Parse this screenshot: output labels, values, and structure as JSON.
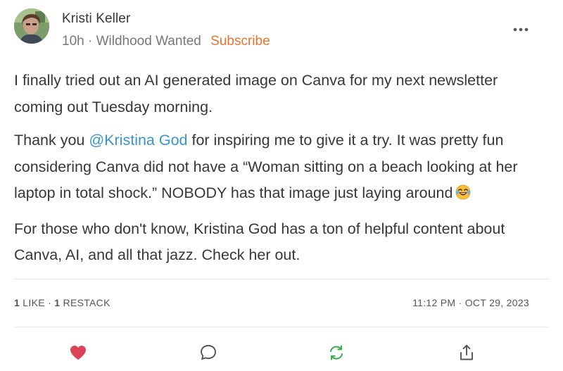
{
  "author": {
    "name": "Kristi Keller",
    "time": "10h",
    "separator": "·",
    "publication": "Wildhood Wanted",
    "subscribe_label": "Subscribe"
  },
  "post": {
    "p1": "I finally tried out an AI generated image on Canva for my next newsletter coming out Tuesday morning.",
    "p2_before": "Thank you ",
    "p2_mention": "@Kristina God",
    "p2_after": " for inspiring me to give it a try. It was pretty fun considering Canva did not have a “Woman sitting on a beach looking at her laptop in total shock.” NOBODY has that image just laying around",
    "p3": "For those who don't know, Kristina God has a ton of helpful content about Canva, AI, and all that jazz. Check her out."
  },
  "stats": {
    "likes_count": "1",
    "likes_label": "LIKE",
    "dot": "·",
    "restacks_count": "1",
    "restacks_label": "RESTACK"
  },
  "timestamp": "11:12 PM · OCT 29, 2023",
  "icons": {
    "more": "more-horizontal-icon",
    "emoji": "laughing-tears-emoji-icon",
    "like": "heart-icon",
    "comment": "comment-bubble-icon",
    "restack": "restack-arrows-icon",
    "share": "share-icon"
  },
  "colors": {
    "accent_subscribe": "#E8742A",
    "mention": "#3A95C8",
    "heart": "#D94457",
    "restack": "#3BAA4A",
    "text": "#363737",
    "muted": "#777777"
  }
}
